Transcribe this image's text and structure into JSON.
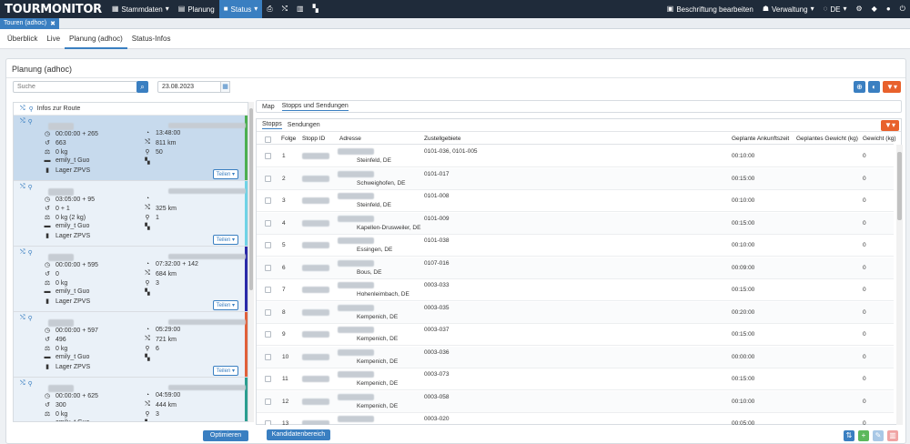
{
  "nav": {
    "logo": "TOURMONITOR",
    "items": [
      "Stammdaten",
      "Planung",
      "Status"
    ],
    "right": {
      "edit_labels": "Beschriftung bearbeiten",
      "admin": "Verwaltung",
      "lang": "DE"
    }
  },
  "doc_tab": {
    "label": "Touren (adhoc)",
    "close": "✖"
  },
  "subtabs": [
    "Überblick",
    "Live",
    "Planung (adhoc)",
    "Status-Infos"
  ],
  "panel": {
    "title": "Planung (adhoc)",
    "search_placeholder": "Suche",
    "date": "23.08.2023",
    "route_header": "Infos zur Route",
    "optimize": "Optimieren",
    "candidate_area": "Kandidatenbereich"
  },
  "share_label": "Teilen ▾",
  "routes": [
    {
      "time": "00:00:00 + 265",
      "end": "13:48:00",
      "count": "663",
      "km": "811 km",
      "weight": "0 kg",
      "stops": "50",
      "user": "emily_t Guo",
      "depot": "Lager ZPVS",
      "color": "#4caf50",
      "selected": true
    },
    {
      "time": "03:05:00 + 95",
      "end": "",
      "count": "0 + 1",
      "km": "325 km",
      "weight": "0 kg (2 kg)",
      "stops": "1",
      "user": "emily_t Guo",
      "depot": "Lager ZPVS",
      "color": "#6fd3e6",
      "selected": false
    },
    {
      "time": "00:00:00 + 595",
      "end": "07:32:00 + 142",
      "count": "0",
      "km": "684 km",
      "weight": "0 kg",
      "stops": "3",
      "user": "emily_t Guo",
      "depot": "Lager ZPVS",
      "color": "#2a2aa8",
      "selected": false
    },
    {
      "time": "00:00:00 + 597",
      "end": "05:29:00",
      "count": "496",
      "km": "721 km",
      "weight": "0 kg",
      "stops": "6",
      "user": "emily_t Guo",
      "depot": "Lager ZPVS",
      "color": "#e0603a",
      "selected": false
    },
    {
      "time": "00:00:00 + 625",
      "end": "04:59:00",
      "count": "300",
      "km": "444 km",
      "weight": "0 kg",
      "stops": "3",
      "user": "emily_t Guo",
      "depot": "Lager ZPVS",
      "color": "#2a9d8f",
      "selected": false
    }
  ],
  "right_tabs": [
    "Map",
    "Stopps und Sendungen"
  ],
  "inner_tabs": [
    "Stopps",
    "Sendungen"
  ],
  "columns": [
    "Folge",
    "Stopp ID",
    "Adresse",
    "Zustellgebiete",
    "Geplante Ankunftszeit",
    "Geplantes Gewicht (kg)",
    "Gewicht (kg)"
  ],
  "stops": [
    {
      "n": "1",
      "addr": "Steinfeld, DE",
      "zone": "0101-036, 0101-005",
      "eta": "00:10:00",
      "w": "0"
    },
    {
      "n": "2",
      "addr": "Schweighofen, DE",
      "zone": "0101-017",
      "eta": "00:15:00",
      "w": "0"
    },
    {
      "n": "3",
      "addr": "Steinfeld, DE",
      "zone": "0101-008",
      "eta": "00:10:00",
      "w": "0"
    },
    {
      "n": "4",
      "addr": "Kapellen-Drusweiler, DE",
      "zone": "0101-009",
      "eta": "00:15:00",
      "w": "0"
    },
    {
      "n": "5",
      "addr": "Essingen, DE",
      "zone": "0101-038",
      "eta": "00:10:00",
      "w": "0"
    },
    {
      "n": "6",
      "addr": "Bous, DE",
      "zone": "0107-016",
      "eta": "00:09:00",
      "w": "0"
    },
    {
      "n": "7",
      "addr": "Hohenleimbach, DE",
      "zone": "0003-033",
      "eta": "00:15:00",
      "w": "0"
    },
    {
      "n": "8",
      "addr": "Kempenich, DE",
      "zone": "0003-035",
      "eta": "00:20:00",
      "w": "0"
    },
    {
      "n": "9",
      "addr": "Kempenich, DE",
      "zone": "0003-037",
      "eta": "00:15:00",
      "w": "0"
    },
    {
      "n": "10",
      "addr": "Kempenich, DE",
      "zone": "0003-036",
      "eta": "00:00:00",
      "w": "0"
    },
    {
      "n": "11",
      "addr": "Kempenich, DE",
      "zone": "0003-073",
      "eta": "00:15:00",
      "w": "0"
    },
    {
      "n": "12",
      "addr": "Kempenich, DE",
      "zone": "0003-058",
      "eta": "00:10:00",
      "w": "0"
    },
    {
      "n": "13",
      "addr": "",
      "zone": "0003-020",
      "eta": "00:05:00",
      "w": "0"
    }
  ]
}
